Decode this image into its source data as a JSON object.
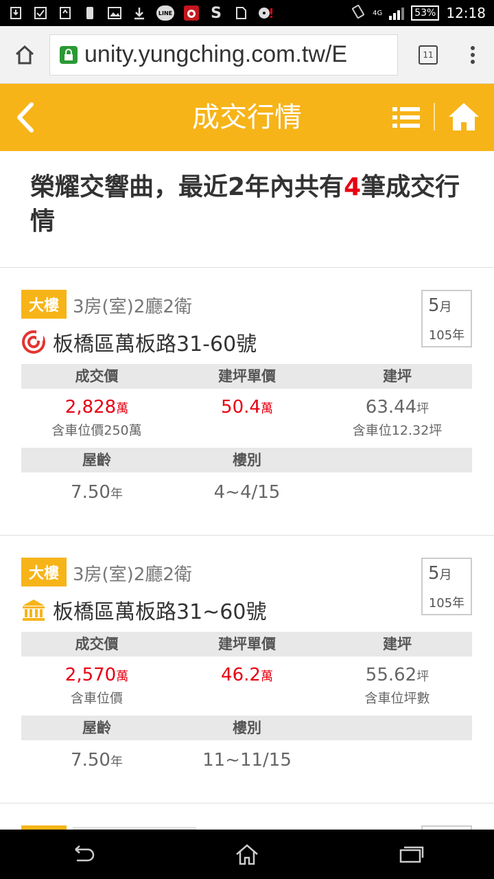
{
  "status_bar": {
    "network": "4G",
    "battery": "53%",
    "time": "12:18"
  },
  "browser": {
    "url": "unity.yungching.com.tw/E",
    "tab_count": "11"
  },
  "header": {
    "title": "成交行情"
  },
  "headline": {
    "prefix": "榮耀交響曲，最近2年內共有",
    "count": "4",
    "suffix": "筆成交行情"
  },
  "columns": {
    "price": "成交價",
    "unit_price": "建坪單價",
    "area": "建坪",
    "age": "屋齡",
    "floor": "樓別"
  },
  "units": {
    "wan": "萬",
    "ping": "坪",
    "year": "年"
  },
  "listings": [
    {
      "type": "大樓",
      "layout": "3房(室)2廳2衛",
      "address": "板橋區萬板路31-60號",
      "icon": "target-icon",
      "month": "5",
      "month_unit": "月",
      "year": "105年",
      "price": "2,828",
      "price_note": "含車位價250萬",
      "unit_price": "50.4",
      "area": "63.44",
      "area_note": "含車位12.32坪",
      "age": "7.50",
      "floor": "4~4/15"
    },
    {
      "type": "大樓",
      "layout": "3房(室)2廳2衛",
      "address": "板橋區萬板路31~60號",
      "icon": "bank-icon",
      "month": "5",
      "month_unit": "月",
      "year": "105年",
      "price": "2,570",
      "price_note": "含車位價",
      "unit_price": "46.2",
      "area": "55.62",
      "area_note": "含車位坪數",
      "age": "7.50",
      "floor": "11~11/15"
    }
  ],
  "colors": {
    "accent": "#f7b418",
    "price_red": "#e60012"
  }
}
